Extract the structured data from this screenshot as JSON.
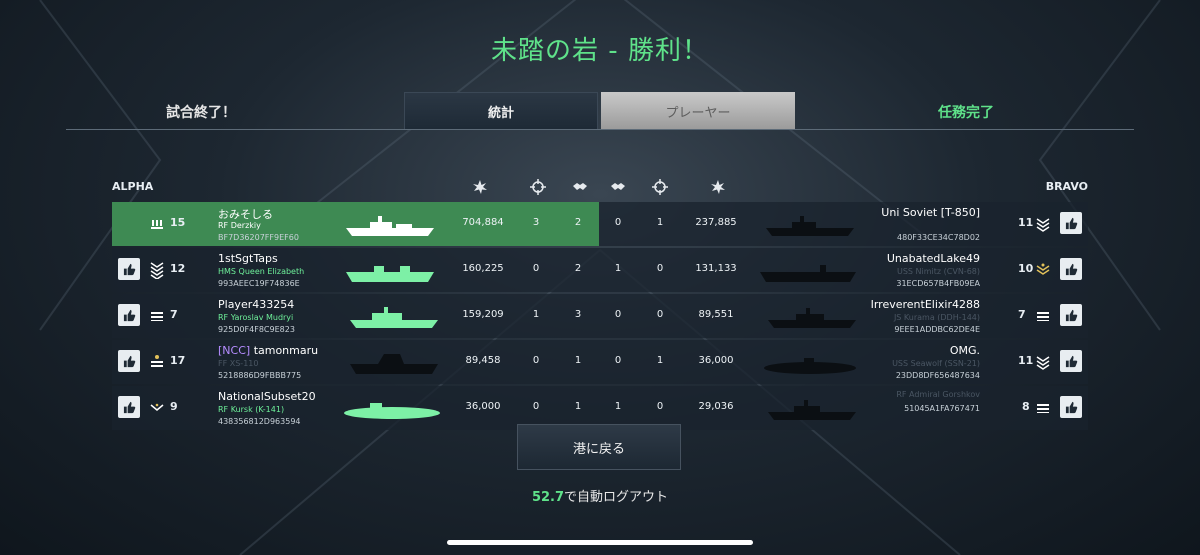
{
  "title": "未踏の岩 - 勝利！",
  "status_left": "試合終了！",
  "status_right": "任務完了",
  "tabs": [
    "統計",
    "プレーヤー"
  ],
  "teams": {
    "alpha": "ALPHA",
    "bravo": "BRAVO"
  },
  "columns": [
    "damage-icon",
    "crosshair-icon",
    "assist-icon",
    "assist-icon",
    "crosshair-icon",
    "damage-icon"
  ],
  "rows": [
    {
      "highlight": true,
      "alpha": {
        "rank": "15",
        "name": "おみそしる",
        "tag": "",
        "ship": "RF Derzkiy",
        "id": "BF7D36207FF9EF60",
        "damage": "704,884",
        "kills": "3",
        "assists": "2",
        "ship_visible": true,
        "has_like": false
      },
      "bravo": {
        "rank": "11",
        "name": "Uni Soviet [T-850]",
        "tag": "",
        "ship": "",
        "id": "480F33CE34C78D02",
        "damage": "237,885",
        "kills": "1",
        "assists": "0",
        "ship_visible": false,
        "has_like": true
      }
    },
    {
      "highlight": false,
      "alpha": {
        "rank": "12",
        "name": "1stSgtTaps",
        "tag": "",
        "ship": "HMS Queen Elizabeth",
        "id": "993AEEC19F74836E",
        "damage": "160,225",
        "kills": "0",
        "assists": "2",
        "ship_visible": true,
        "has_like": true
      },
      "bravo": {
        "rank": "10",
        "name": "UnabatedLake49",
        "tag": "",
        "ship": "USS Nimitz (CVN-68)",
        "id": "31ECD657B4FB09EA",
        "damage": "131,133",
        "kills": "0",
        "assists": "1",
        "ship_visible": false,
        "has_like": true
      }
    },
    {
      "highlight": false,
      "alpha": {
        "rank": "7",
        "name": "Player433254",
        "tag": "",
        "ship": "RF Yaroslav Mudryi",
        "id": "925D0F4F8C9E823",
        "damage": "159,209",
        "kills": "1",
        "assists": "3",
        "ship_visible": true,
        "has_like": true
      },
      "bravo": {
        "rank": "7",
        "name": "IrreverentElixir4288",
        "tag": "",
        "ship": "JS Kurama (DDH-144)",
        "id": "9EEE1ADDBC62DE4E",
        "damage": "89,551",
        "kills": "0",
        "assists": "0",
        "ship_visible": false,
        "has_like": true
      }
    },
    {
      "highlight": false,
      "alpha": {
        "rank": "17",
        "name": "tamonmaru",
        "tag": "[NCC]",
        "ship": "FF XS-110",
        "id": "5218886D9FBBB775",
        "damage": "89,458",
        "kills": "0",
        "assists": "1",
        "ship_visible": false,
        "has_like": true
      },
      "bravo": {
        "rank": "11",
        "name": "OMG.",
        "tag": "",
        "ship": "USS Seawolf (SSN-21)",
        "id": "23DD8DF656487634",
        "damage": "36,000",
        "kills": "1",
        "assists": "0",
        "ship_visible": false,
        "has_like": true
      }
    },
    {
      "highlight": false,
      "alpha": {
        "rank": "9",
        "name": "NationalSubset20",
        "tag": "",
        "ship": "RF Kursk (K-141)",
        "id": "438356812D963594",
        "damage": "36,000",
        "kills": "0",
        "assists": "1",
        "ship_visible": true,
        "has_like": true
      },
      "bravo": {
        "rank": "8",
        "name": "",
        "tag": "",
        "ship": "RF Admiral Gorshkov",
        "id": "51045A1FA767471",
        "damage": "29,036",
        "kills": "0",
        "assists": "1",
        "ship_visible": false,
        "has_like": true
      }
    }
  ],
  "return_button": "港に戻る",
  "logout_count": "52.7",
  "logout_text": "で自動ログアウト",
  "colors": {
    "accent_green": "#5fe28a",
    "highlight_row": "#3e8a53",
    "ship_green": "#7df0a6",
    "ship_black": "#0b0f13"
  }
}
